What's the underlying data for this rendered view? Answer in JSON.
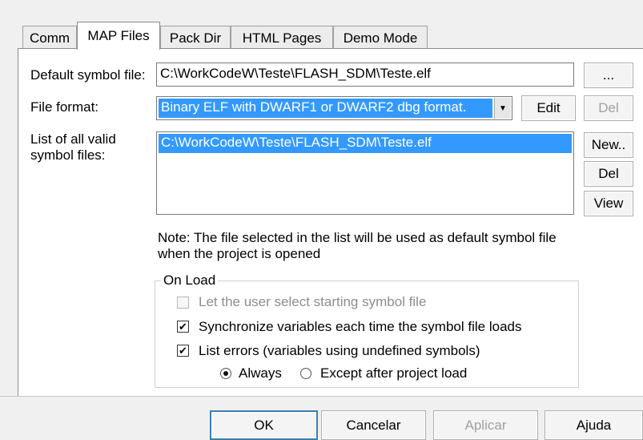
{
  "tabs": [
    {
      "label": "Comm"
    },
    {
      "label": "MAP Files"
    },
    {
      "label": "Pack Dir"
    },
    {
      "label": "HTML Pages"
    },
    {
      "label": "Demo Mode"
    }
  ],
  "form": {
    "default_symbol_label": "Default symbol file:",
    "default_symbol_value": "C:\\WorkCodeW\\Teste\\FLASH_SDM\\Teste.elf",
    "browse_label": "...",
    "file_format_label": "File format:",
    "file_format_value": "Binary ELF with DWARF1 or DWARF2 dbg format.",
    "edit_label": "Edit",
    "del_top_label": "Del",
    "list_label_line1": "List of all valid",
    "list_label_line2": "symbol files:",
    "list_items": [
      "C:\\WorkCodeW\\Teste\\FLASH_SDM\\Teste.elf"
    ],
    "new_label": "New..",
    "del_label": "Del",
    "view_label": "View",
    "note_line1": "Note: The file selected in the list will be used as default symbol file",
    "note_line2": "when the project is opened"
  },
  "on_load": {
    "title": "On Load",
    "let_user_select": {
      "label": "Let the user select starting symbol file",
      "checked": false,
      "enabled": false
    },
    "synchronize": {
      "label": "Synchronize variables each time the symbol file loads",
      "checked": true
    },
    "list_errors": {
      "label": "List errors (variables using undefined symbols)",
      "checked": true
    },
    "always": {
      "label": "Always",
      "selected": true
    },
    "except_after": {
      "label": "Except after project load",
      "selected": false
    }
  },
  "footer": {
    "ok": "OK",
    "cancel": "Cancelar",
    "apply": "Aplicar",
    "help": "Ajuda"
  },
  "icons": {
    "check": "✔",
    "dropdown": "▼"
  }
}
